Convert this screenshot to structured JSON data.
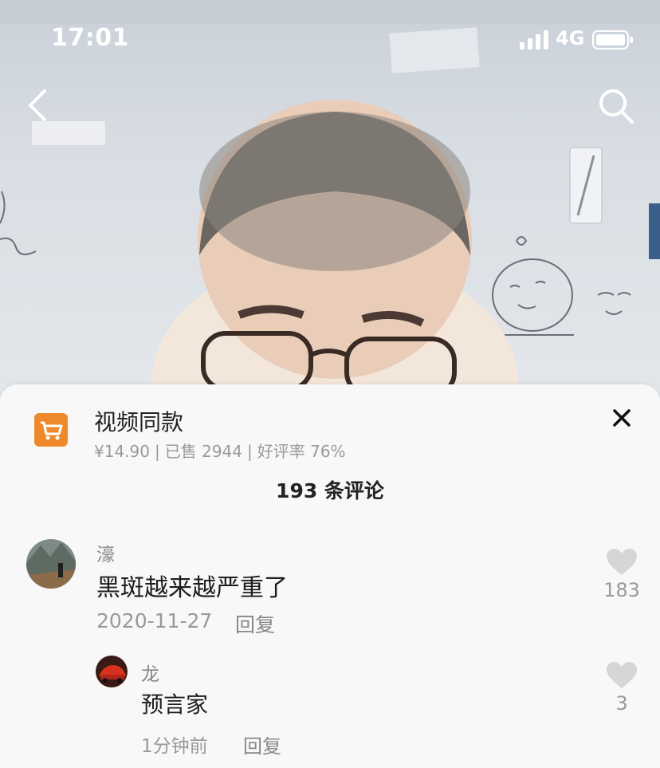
{
  "status": {
    "time": "17:01",
    "network": "4G"
  },
  "nav": {
    "back_icon": "chevron-left-icon",
    "search_icon": "search-icon"
  },
  "product": {
    "title": "视频同款",
    "price": "¥14.90",
    "sold": "已售 2944",
    "rating": "好评率 76%",
    "separator": "|",
    "icon": "shopping-cart-icon",
    "accent": "#ee8a2c"
  },
  "comments_header": {
    "count_label": "193 条评论"
  },
  "comments": [
    {
      "user": "濠",
      "text": "黑斑越来越严重了",
      "date": "2020-11-27",
      "reply_label": "回复",
      "likes": "183"
    }
  ],
  "replies": [
    {
      "user": "龙",
      "text": "预言家",
      "date": "1分钟前",
      "reply_label": "回复",
      "likes": "3"
    }
  ]
}
